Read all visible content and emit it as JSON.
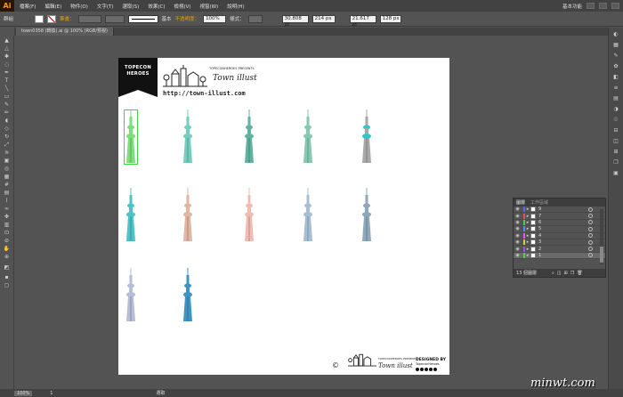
{
  "app": {
    "logo": "Ai",
    "workspace": "基本功能",
    "menus": [
      "檔案(F)",
      "編輯(E)",
      "物件(O)",
      "文字(T)",
      "選取(S)",
      "效果(C)",
      "檢視(V)",
      "視窗(W)",
      "說明(H)"
    ]
  },
  "control": {
    "group_label": "群組",
    "stroke_label": "筆畫：",
    "stroke_style": "基本",
    "opacity_label": "不透明度：",
    "opacity_value": "100%",
    "style_label": "樣式：",
    "x_value": "30.808 pt",
    "y_value": "214 px",
    "w_value": "21.617 pt",
    "h_value": "128 px"
  },
  "document": {
    "tab_title": "town0358 (轉換).ai @ 100% (RGB/預視)"
  },
  "artboard": {
    "badge_line1": "TOPECON",
    "badge_line2": "HEROES",
    "presents": "TOPECONHEROES PRESENTS",
    "town_illust": "Town illust",
    "url": "http://town-illust.com",
    "footer_copyright": "©",
    "footer_presents": "TOPECONHEROES PRESENTS",
    "footer_town": "Town illust",
    "designed_by": "DESIGNED BY",
    "designer": "TopeconHeroes"
  },
  "towers": [
    {
      "color": "#7ae07a",
      "selected": true
    },
    {
      "color": "#72cfc0"
    },
    {
      "color": "#5fb3a0"
    },
    {
      "color": "#86c9b0"
    },
    {
      "color": "#a8a8a8",
      "accent": "#2cc7d0"
    },
    {
      "color": "#4cc3c8"
    },
    {
      "color": "#e3b6a3"
    },
    {
      "color": "#f0bcb4"
    },
    {
      "color": "#a6bfd6"
    },
    {
      "color": "#8fa8ba"
    },
    {
      "color": "#b6bdd6"
    },
    {
      "color": "#3e95c4"
    }
  ],
  "layers_panel": {
    "tab_layers": "圖層",
    "tab_artboards": "工作區域",
    "footer": "13 個圖層",
    "rows": [
      {
        "name": "9",
        "color": "#4a6cff"
      },
      {
        "name": "7",
        "color": "#ff4a4a"
      },
      {
        "name": "6",
        "color": "#4ad04a"
      },
      {
        "name": "5",
        "color": "#4a90ff"
      },
      {
        "name": "4",
        "color": "#ff4aff"
      },
      {
        "name": "3",
        "color": "#d0d04a"
      },
      {
        "name": "2",
        "color": "#a04aff"
      },
      {
        "name": "1",
        "color": "#4ad04a",
        "active": true
      }
    ]
  },
  "status": {
    "zoom": "100%",
    "page": "1",
    "mode": "選取"
  },
  "watermark": "minwt.com"
}
